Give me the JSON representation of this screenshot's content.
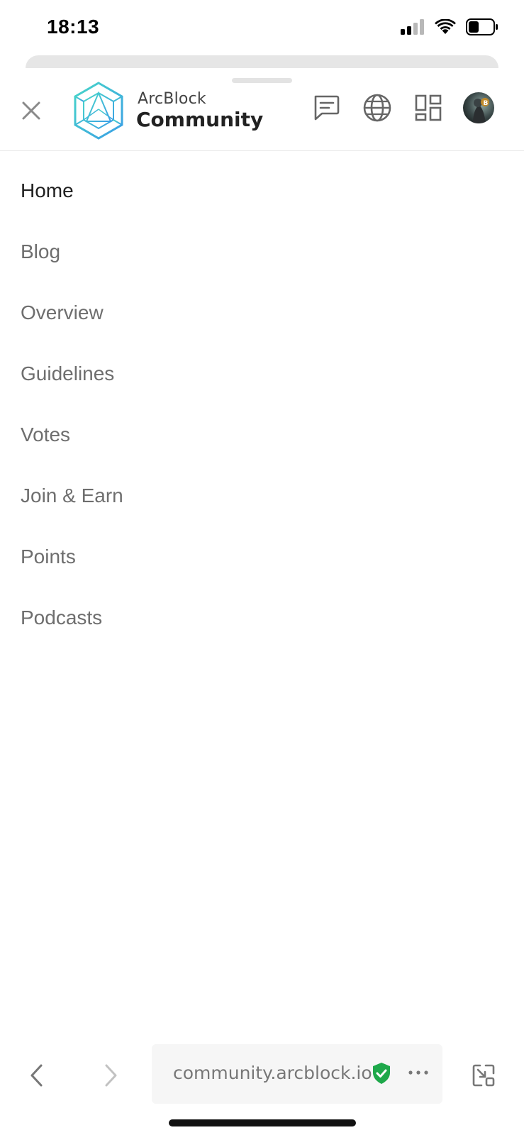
{
  "status_bar": {
    "time": "18:13",
    "icons": [
      "cellular-signal-icon",
      "wifi-icon",
      "battery-icon"
    ]
  },
  "header": {
    "close_icon": "close-icon",
    "brand_small": "ArcBlock",
    "brand_big": "Community",
    "logo_color": "#3fc3d9",
    "icons": [
      "chat-icon",
      "globe-icon",
      "apps-grid-icon"
    ]
  },
  "menu": {
    "items": [
      {
        "label": "Home",
        "active": true
      },
      {
        "label": "Blog",
        "active": false
      },
      {
        "label": "Overview",
        "active": false
      },
      {
        "label": "Guidelines",
        "active": false
      },
      {
        "label": "Votes",
        "active": false
      },
      {
        "label": "Join & Earn",
        "active": false
      },
      {
        "label": "Points",
        "active": false
      },
      {
        "label": "Podcasts",
        "active": false
      }
    ]
  },
  "browser_bar": {
    "url": "community.arcblock.io",
    "secure_color": "#1ea84a",
    "icons": [
      "back-arrow-icon",
      "forward-arrow-icon",
      "more-dots-icon",
      "minimize-icon"
    ]
  }
}
